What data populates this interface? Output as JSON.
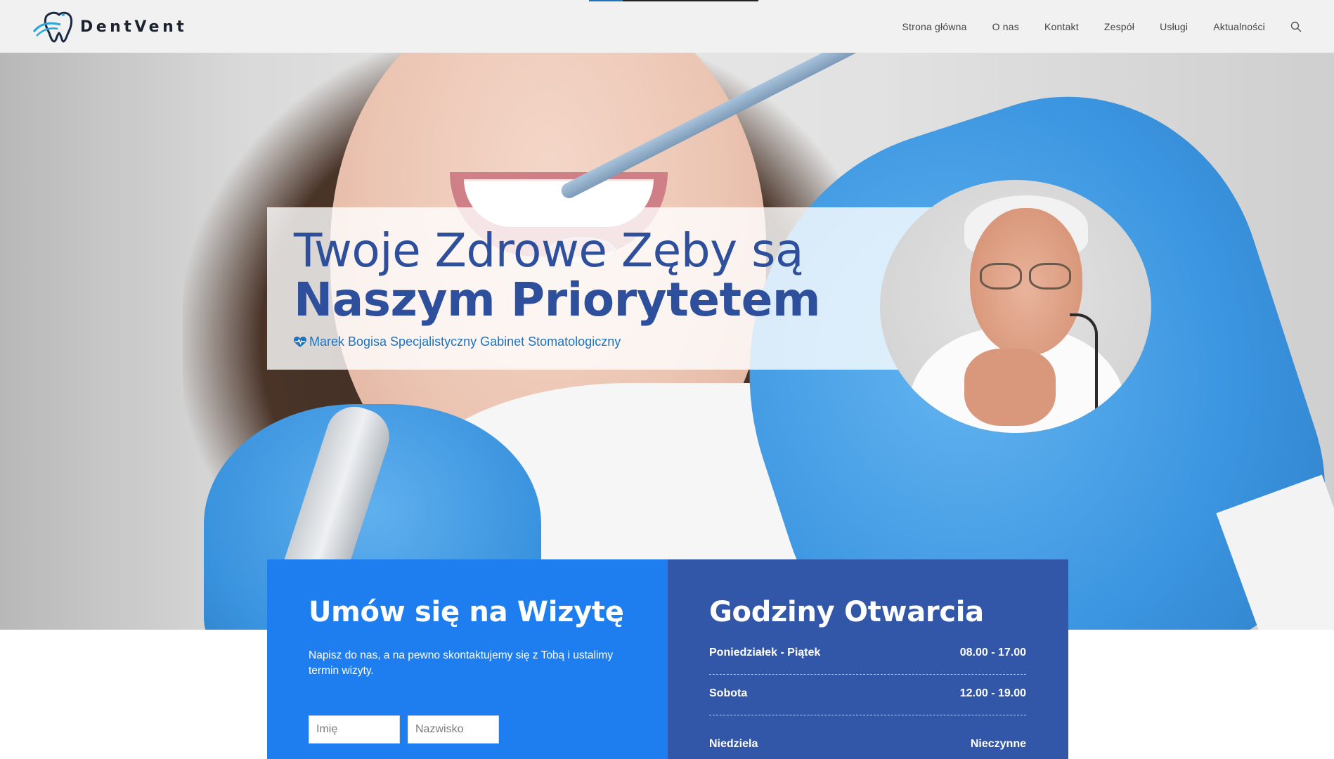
{
  "header": {
    "logo_text": "DentVent",
    "nav": [
      "Strona główna",
      "O nas",
      "Kontakt",
      "Zespół",
      "Usługi",
      "Aktualności"
    ]
  },
  "hero": {
    "line1": "Twoje Zdrowe Zęby są",
    "line2": "Naszym Priorytetem",
    "subtitle": "Marek Bogisa Specjalistyczny Gabinet Stomatologiczny"
  },
  "appointment": {
    "title_light": "Umów się na",
    "title_bold": "Wizytę",
    "description": "Napisz do nas, a na pewno skontaktujemy się z Tobą i ustalimy termin wizyty.",
    "first_name_placeholder": "Imię",
    "last_name_placeholder": "Nazwisko"
  },
  "hours": {
    "title_light": "Godziny",
    "title_bold": "Otwarcia",
    "rows": [
      {
        "day": "Poniedziałek - Piątek",
        "time": "08.00 - 17.00"
      },
      {
        "day": "Sobota",
        "time": "12.00 - 19.00"
      },
      {
        "day": "Niedziela",
        "time": "Nieczynne"
      }
    ]
  },
  "colors": {
    "accent_blue": "#1e7ef0",
    "dark_blue": "#3357a8",
    "headline_blue": "#2e4f9c",
    "link_blue": "#1e73be"
  },
  "icons": {
    "logo": "tooth-logo-icon",
    "search": "search-icon",
    "subtitle": "heartbeat-icon"
  }
}
